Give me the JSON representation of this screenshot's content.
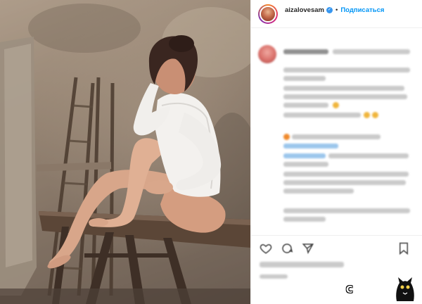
{
  "post": {
    "username": "aizalovesam",
    "follow_label": "Подписаться",
    "separator": "•",
    "verified_mark": "✓"
  },
  "photo": {
    "name": "post-photo"
  },
  "icons": {
    "like": "heart-icon",
    "comment": "comment-icon",
    "share": "share-icon",
    "save": "bookmark-icon",
    "verified": "verified-badge-icon"
  },
  "watermark": {
    "text": "С"
  },
  "colors": {
    "follow_blue": "#0095f6",
    "verified_blue": "#3897f0",
    "border": "#efefef"
  }
}
